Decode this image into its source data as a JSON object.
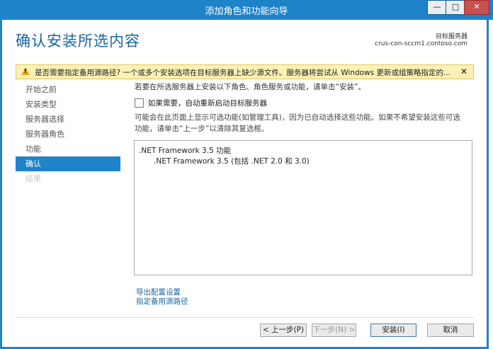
{
  "window": {
    "title": "添加角色和功能向导",
    "minimize": "—",
    "maximize": "□",
    "close": "✕"
  },
  "header": {
    "title": "确认安装所选内容",
    "dest_label": "目标服务器",
    "dest_server": "crus-con-sccm1.contoso.com"
  },
  "warning": {
    "text": "是否需要指定备用源路径? 一个或多个安装选项在目标服务器上缺少源文件。服务器将尝试从 Windows 更新或组策略指定的...",
    "close": "✕",
    "icon": "warning-icon"
  },
  "nav": {
    "items": [
      {
        "label": "开始之前"
      },
      {
        "label": "安装类型"
      },
      {
        "label": "服务器选择"
      },
      {
        "label": "服务器角色"
      },
      {
        "label": "功能"
      },
      {
        "label": "确认"
      },
      {
        "label": "结果"
      }
    ]
  },
  "main": {
    "intro": "若要在所选服务器上安装以下角色、角色服务或功能，请单击“安装”。",
    "restart_checkbox": "如果需要，自动重新启动目标服务器",
    "note": "可能会在此页面上显示可选功能(如管理工具)，因为已自动选择这些功能。如果不希望安装这些可选功能，请单击“上一步”以清除其复选框。",
    "features": [
      ".NET Framework 3.5 功能",
      ".NET Framework 3.5 (包括 .NET 2.0 和 3.0)"
    ],
    "link_export": "导出配置设置",
    "link_source": "指定备用源路径"
  },
  "footer": {
    "prev": "< 上一步(P)",
    "next": "下一步(N) >",
    "install": "安装(I)",
    "cancel": "取消"
  }
}
